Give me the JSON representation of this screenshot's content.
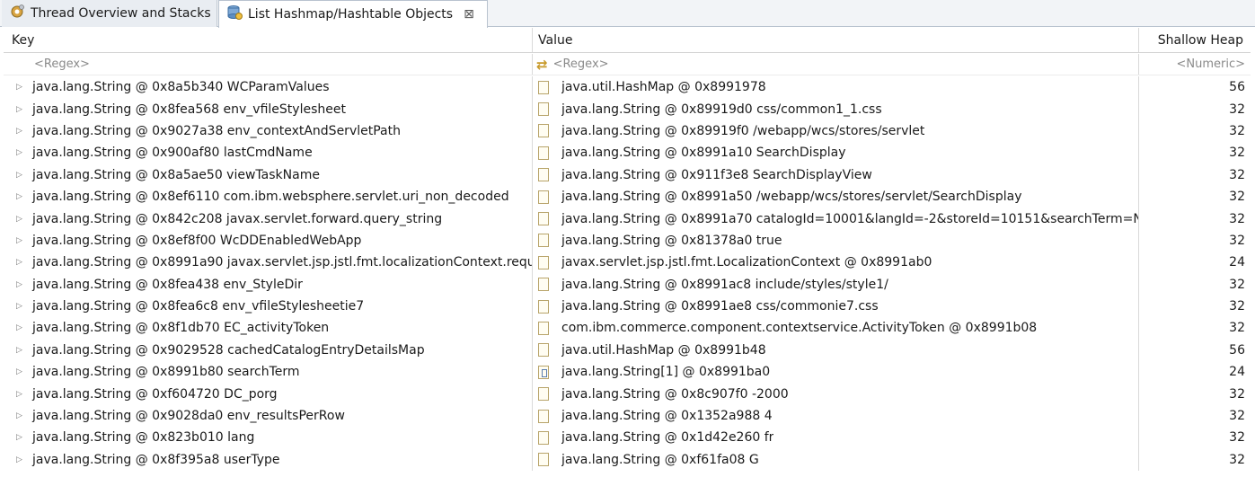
{
  "tabs": [
    {
      "label": "Thread Overview and Stacks",
      "icon": "gear-icon"
    },
    {
      "label": "List Hashmap/Hashtable Objects",
      "icon": "db-icon",
      "close": "⊠"
    }
  ],
  "table": {
    "headers": {
      "key": "Key",
      "value": "Value",
      "heap": "Shallow Heap"
    },
    "filters": {
      "key": "<Regex>",
      "value": "<Regex>",
      "heap": "<Numeric>"
    },
    "rows": [
      {
        "key": "java.lang.String @ 0x8a5b340  WCParamValues",
        "value": "java.util.HashMap @ 0x8991978",
        "heap": "56"
      },
      {
        "key": "java.lang.String @ 0x8fea568  env_vfileStylesheet",
        "value": "java.lang.String @ 0x89919d0  css/common1_1.css",
        "heap": "32"
      },
      {
        "key": "java.lang.String @ 0x9027a38  env_contextAndServletPath",
        "value": "java.lang.String @ 0x89919f0  /webapp/wcs/stores/servlet",
        "heap": "32"
      },
      {
        "key": "java.lang.String @ 0x900af80  lastCmdName",
        "value": "java.lang.String @ 0x8991a10  SearchDisplay",
        "heap": "32"
      },
      {
        "key": "java.lang.String @ 0x8a5ae50  viewTaskName",
        "value": "java.lang.String @ 0x911f3e8  SearchDisplayView",
        "heap": "32"
      },
      {
        "key": "java.lang.String @ 0x8ef6110  com.ibm.websphere.servlet.uri_non_decoded",
        "value": "java.lang.String @ 0x8991a50  /webapp/wcs/stores/servlet/SearchDisplay",
        "heap": "32"
      },
      {
        "key": "java.lang.String @ 0x842c208  javax.servlet.forward.query_string",
        "value": "java.lang.String @ 0x8991a70  catalogId=10001&langId=-2&storeId=10151&searchTerm=N",
        "heap": "32"
      },
      {
        "key": "java.lang.String @ 0x8ef8f00  WcDDEnabledWebApp",
        "value": "java.lang.String @ 0x81378a0  true",
        "heap": "32"
      },
      {
        "key": "java.lang.String @ 0x8991a90  javax.servlet.jsp.jstl.fmt.localizationContext.requ",
        "value": "javax.servlet.jsp.jstl.fmt.LocalizationContext @ 0x8991ab0",
        "heap": "24"
      },
      {
        "key": "java.lang.String @ 0x8fea438  env_StyleDir",
        "value": "java.lang.String @ 0x8991ac8  include/styles/style1/",
        "heap": "32"
      },
      {
        "key": "java.lang.String @ 0x8fea6c8  env_vfileStylesheetie7",
        "value": "java.lang.String @ 0x8991ae8  css/commonie7.css",
        "heap": "32"
      },
      {
        "key": "java.lang.String @ 0x8f1db70  EC_activityToken",
        "value": "com.ibm.commerce.component.contextservice.ActivityToken @ 0x8991b08",
        "heap": "32"
      },
      {
        "key": "java.lang.String @ 0x9029528  cachedCatalogEntryDetailsMap",
        "value": "java.util.HashMap @ 0x8991b48",
        "heap": "56"
      },
      {
        "key": "java.lang.String @ 0x8991b80  searchTerm",
        "value": "java.lang.String[1] @ 0x8991ba0",
        "heap": "24",
        "array": true
      },
      {
        "key": "java.lang.String @ 0xf604720  DC_porg",
        "value": "java.lang.String @ 0x8c907f0  -2000",
        "heap": "32"
      },
      {
        "key": "java.lang.String @ 0x9028da0  env_resultsPerRow",
        "value": "java.lang.String @ 0x1352a988  4",
        "heap": "32"
      },
      {
        "key": "java.lang.String @ 0x823b010  lang",
        "value": "java.lang.String @ 0x1d42e260  fr",
        "heap": "32"
      },
      {
        "key": "java.lang.String @ 0x8f395a8  userType",
        "value": "java.lang.String @ 0xf61fa08  G",
        "heap": "32"
      }
    ]
  }
}
